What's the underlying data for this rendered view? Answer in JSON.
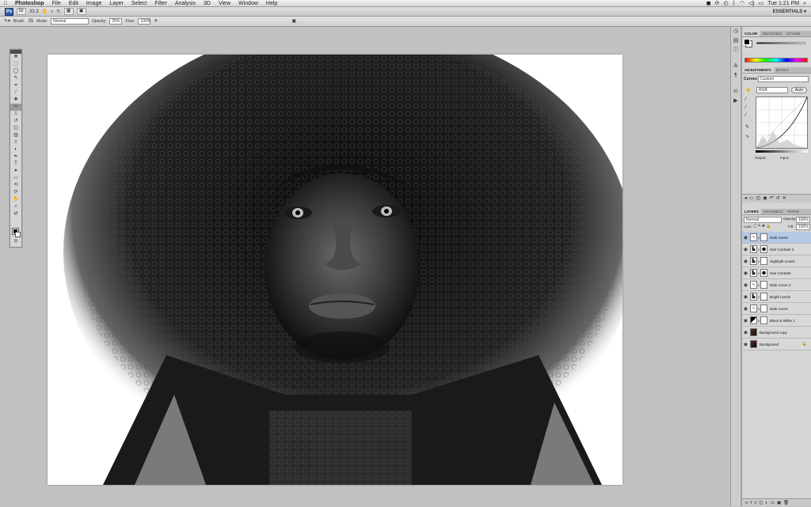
{
  "menubar": {
    "apple": "",
    "items": [
      "Photoshop",
      "File",
      "Edit",
      "Image",
      "Layer",
      "Select",
      "Filter",
      "Analysis",
      "3D",
      "View",
      "Window",
      "Help"
    ],
    "clock": "Tue 1:21 PM"
  },
  "appbar": {
    "logo": "Ps",
    "zoom": "33.3",
    "workspace": "ESSENTIALS ▾"
  },
  "options": {
    "brush_label": "Brush:",
    "brush_size": "35",
    "mode_label": "Mode:",
    "mode_value": "Normal",
    "opacity_label": "Opacity:",
    "opacity_value": "25%",
    "flow_label": "Flow:",
    "flow_value": "100%"
  },
  "panels": {
    "color_tabs": [
      "COLOR",
      "SWATCHES",
      "STYLES"
    ],
    "adj_tabs": [
      "ADJUSTMENTS",
      "MASKS"
    ],
    "curves_label": "Curves",
    "preset_value": "Custom",
    "channel_value": "RGB",
    "auto_label": "Auto",
    "output_label": "Output:",
    "input_label": "Input:",
    "layer_tabs": [
      "LAYERS",
      "CHANNELS",
      "PATHS"
    ],
    "blend_value": "Normal",
    "opacity_label": "Opacity:",
    "opacity_value": "100%",
    "lock_label": "Lock:",
    "fill_label": "Fill:",
    "fill_value": "100%"
  },
  "layers": [
    {
      "name": "Dark Curve",
      "selected": true
    },
    {
      "name": "Hair Contrast 2"
    },
    {
      "name": "Highlight Levels"
    },
    {
      "name": "Hair Contrast"
    },
    {
      "name": "Dark Curve 2"
    },
    {
      "name": "Bright Levels"
    },
    {
      "name": "Dark Curve"
    },
    {
      "name": "Black & White 1"
    },
    {
      "name": "Background copy"
    },
    {
      "name": "Background"
    }
  ],
  "colors": {
    "ps_blue": "#2a5ea8",
    "selection": "#b5c8e4"
  }
}
